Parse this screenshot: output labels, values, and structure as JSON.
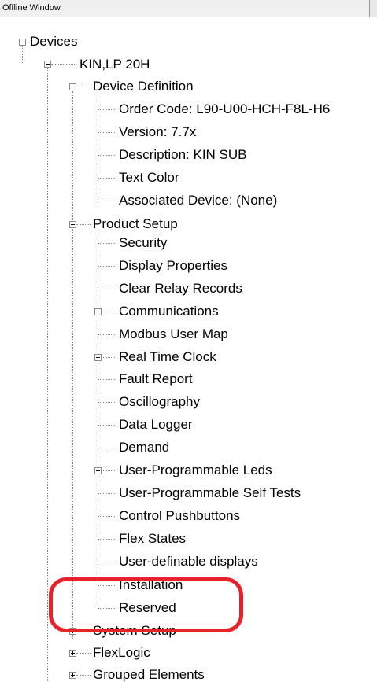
{
  "window": {
    "title": "Offline Window"
  },
  "tree": {
    "root": "Devices",
    "device": "KIN,LP 20H",
    "device_definition": {
      "label": "Device Definition",
      "children": [
        "Order Code: L90-U00-HCH-F8L-H6",
        "Version: 7.7x",
        "Description: KIN SUB",
        "Text Color",
        "Associated Device: (None)"
      ]
    },
    "product_setup": {
      "label": "Product Setup",
      "children": [
        "Security",
        "Display Properties",
        "Clear Relay Records",
        "Communications",
        "Modbus User Map",
        "Real Time Clock",
        "Fault Report",
        "Oscillography",
        "Data Logger",
        "Demand",
        "User-Programmable Leds",
        "User-Programmable Self Tests",
        "Control Pushbuttons",
        "Flex States",
        "User-definable displays",
        "Installation",
        "Reserved"
      ]
    },
    "system_setup": "System Setup",
    "flexlogic": "FlexLogic",
    "grouped_elements": "Grouped Elements"
  },
  "annotation": {
    "color": "#e8222b"
  }
}
